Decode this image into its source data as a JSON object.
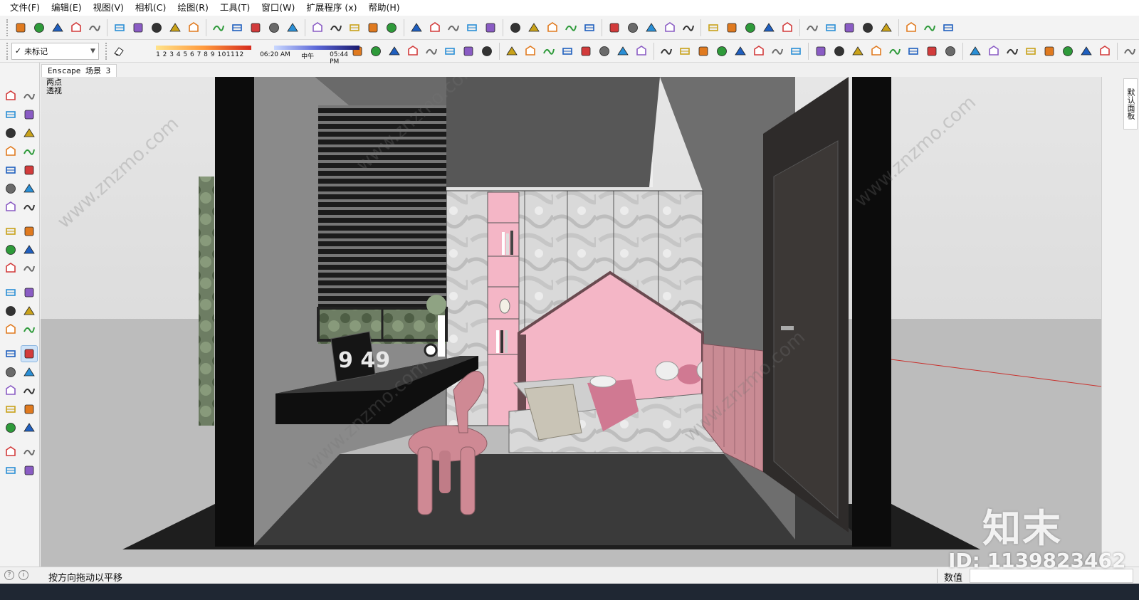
{
  "menu": [
    "文件(F)",
    "编辑(E)",
    "视图(V)",
    "相机(C)",
    "绘图(R)",
    "工具(T)",
    "窗口(W)",
    "扩展程序 (x)",
    "帮助(H)"
  ],
  "tags": {
    "current": "未标记"
  },
  "shadow": {
    "months": "1 2 3 4 5 6 7 8 9 101112",
    "time_start": "06:20 AM",
    "time_mid": "中午",
    "time_end": "05:44 PM"
  },
  "scene_tab": "Enscape 场景 3",
  "camera": {
    "line1": "两点",
    "line2": "透视"
  },
  "tray": {
    "tab": "默认面板"
  },
  "status": {
    "hint": "按方向拖动以平移",
    "vcb_label": "数值",
    "vcb_value": ""
  },
  "scene": {
    "clock_text": "9 49"
  },
  "watermark": {
    "logo": "知末",
    "id": "ID: 1139823462",
    "site": "www.znzmo.com"
  },
  "colors": {
    "pink": "#f4b6c6",
    "chair": "#cf8994",
    "wall": "#7a7a7a",
    "floor": "#2b2b2b",
    "sky": "#dcdcdc"
  },
  "toolbar1_icons": [
    "enscape-logo-icon",
    "enscape-refresh-icon",
    "enscape-sync-icon",
    "add-icon",
    "tree-icon",
    "mountain-icon",
    "checker-icon",
    "cloud-upload-icon",
    "settings-gear-icon",
    "mail-icon",
    "info-icon",
    "box-shaded-icon",
    "box-wire-icon",
    "box-front-icon",
    "box-outline-icon",
    "box-back-icon",
    "box-monochrome-icon",
    "box-style-icon",
    "component-icon",
    "component-box-icon",
    "home-icon",
    "roof-icon",
    "house-icon",
    "house-open-icon",
    "group-icon",
    "stack-icon",
    "group-left-icon",
    "group-right-icon",
    "group-stack-icon",
    "group-blue-icon",
    "color-cube-icon",
    "scissors-icon",
    "cloud-link-icon",
    "cloud-search-icon",
    "cloud-check-icon",
    "cloud-curve-icon",
    "frame-icon",
    "network-icon",
    "refresh-check-icon",
    "chrome-icon",
    "play-icon",
    "pause-icon",
    "record-icon",
    "stop-icon",
    "gear-blue-icon",
    "window-icon",
    "panel-icon",
    "help-icon"
  ],
  "toolbar2_icons": [
    "eraser-icon",
    "stairs-icon",
    "grid-icon",
    "ramp-icon",
    "chart-icon",
    "move-rail-icon",
    "rail-icon",
    "curve-arrow-icon",
    "arrow-split-icon",
    "bracket-icon",
    "loop-icon",
    "spiral-icon",
    "rope-icon",
    "bar-icon",
    "brush-icon",
    "layers-icon",
    "layers-alt-icon",
    "books-icon",
    "stack-alt-icon",
    "arch-icon",
    "chain-icon",
    "wave-icon",
    "spiral-alt-icon",
    "column-icon",
    "colonnade-icon",
    "colonnade-alt-icon",
    "tent-icon",
    "dots-grid-icon",
    "panel-dark-icon",
    "figure-icon",
    "broom-icon",
    "box-target-icon",
    "box-spin-icon",
    "move-axis-icon",
    "cube-blue-icon",
    "cube-blue-alt-icon",
    "cube-blue-light-icon",
    "ladder-icon",
    "stack-red-icon",
    "bookmark-red-icon",
    "run-figure-icon"
  ],
  "left_tools": [
    [
      "select-icon",
      "component-make-icon"
    ],
    [
      "paint-bucket-icon",
      "eraser-pink-icon"
    ],
    [
      "pencil-icon",
      "freehand-icon"
    ],
    [
      "rectangle-icon",
      "rotated-rectangle-icon"
    ],
    [
      "circle-icon",
      "polygon-icon"
    ],
    [
      "arc-icon",
      "arc-2pt-icon"
    ],
    [
      "pie-icon",
      "arc-3pt-icon"
    ],
    [
      "move-icon",
      "push-pull-icon"
    ],
    [
      "rotate-icon",
      "follow-me-icon"
    ],
    [
      "scale-icon",
      "offset-icon"
    ],
    [
      "tape-measure-icon",
      "dimension-icon"
    ],
    [
      "protractor-icon",
      "text-icon"
    ],
    [
      "axes-icon",
      "3d-text-icon"
    ],
    [
      "orbit-icon",
      "pan-icon"
    ],
    [
      "zoom-icon",
      "zoom-window-icon"
    ],
    [
      "zoom-extents-icon",
      "position-camera-icon"
    ],
    [
      "walk-icon",
      "look-around-icon"
    ],
    [
      "footprints-icon",
      "section-plane-icon"
    ],
    [
      "sandbox-contours-icon",
      "sandbox-scratch-icon"
    ],
    [
      "stamp-icon",
      "drape-icon"
    ]
  ]
}
